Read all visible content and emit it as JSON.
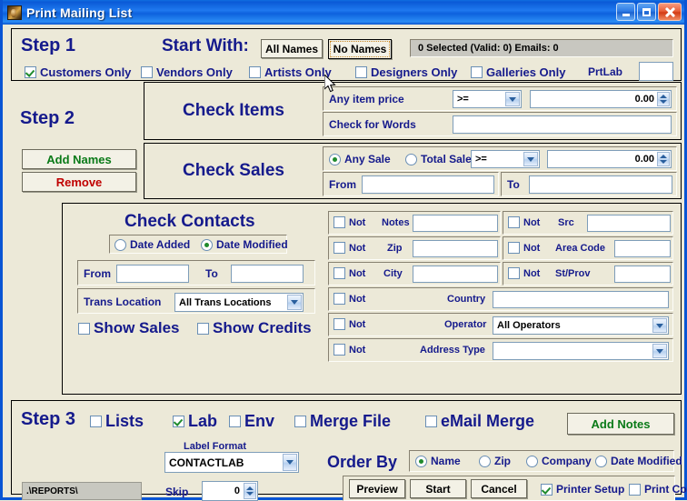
{
  "window": {
    "title": "Print Mailing List",
    "icon": "app-icon",
    "buttons": {
      "minimize": "_",
      "maximize": "□",
      "close": "✕"
    }
  },
  "step1": {
    "label": "Step 1",
    "start_with_label": "Start With:",
    "all_names_button": "All Names",
    "no_names_button": "No Names",
    "status": "0 Selected      (Valid: 0)  Emails: 0",
    "prtlab_label": "PrtLab",
    "prtlab_value": "",
    "checkboxes": [
      {
        "label": "Customers Only",
        "checked": true,
        "accel": "C"
      },
      {
        "label": "Vendors Only",
        "checked": false,
        "accel": "V"
      },
      {
        "label": "Artists Only",
        "checked": false,
        "accel": "A"
      },
      {
        "label": "Designers Only",
        "checked": false,
        "accel": "D"
      },
      {
        "label": "Galleries Only",
        "checked": false,
        "accel": "G"
      }
    ]
  },
  "step2": {
    "label": "Step 2",
    "add_names_button": "Add Names",
    "remove_button": "Remove",
    "check_items": {
      "title": "Check Items",
      "any_item_price_label": "Any item price",
      "operator_value": ">=",
      "operator_options": [
        ">=",
        "<=",
        "=",
        ">",
        "<"
      ],
      "price_value": "0.00",
      "check_for_words_label": "Check for Words",
      "check_for_words_value": ""
    },
    "check_sales": {
      "title": "Check Sales",
      "any_sale_label": "Any Sale",
      "any_sale_checked": true,
      "total_sales_label": "Total Sales",
      "total_sales_checked": false,
      "operator_value": ">=",
      "amount_value": "0.00",
      "from_label": "From",
      "from_value": "",
      "to_label": "To",
      "to_value": ""
    }
  },
  "check_contacts": {
    "title": "Check Contacts",
    "date_added_label": "Date Added",
    "date_added_checked": false,
    "date_modified_label": "Date Modified",
    "date_modified_checked": true,
    "from_label": "From",
    "from_value": "",
    "to_label": "To",
    "to_value": "",
    "trans_location_label": "Trans Location",
    "trans_location_value": "All Trans Locations",
    "show_sales_label": "Show Sales",
    "show_sales_checked": false,
    "show_credits_label": "Show Credits",
    "show_credits_checked": false
  },
  "filters": {
    "not_label": "Not",
    "rows": [
      {
        "name": "notes",
        "label": "Notes",
        "not_checked": false,
        "value": "",
        "type": "text"
      },
      {
        "name": "src",
        "label": "Src",
        "not_checked": false,
        "value": "",
        "type": "text"
      },
      {
        "name": "zip",
        "label": "Zip",
        "not_checked": false,
        "value": "",
        "type": "text"
      },
      {
        "name": "area-code",
        "label": "Area Code",
        "not_checked": false,
        "value": "",
        "type": "text"
      },
      {
        "name": "city",
        "label": "City",
        "not_checked": false,
        "value": "",
        "type": "text"
      },
      {
        "name": "st-prov",
        "label": "St/Prov",
        "not_checked": false,
        "value": "",
        "type": "text"
      },
      {
        "name": "country",
        "label": "Country",
        "not_checked": false,
        "value": "",
        "type": "text"
      },
      {
        "name": "operator",
        "label": "Operator",
        "not_checked": false,
        "value": "All Operators",
        "type": "combo"
      },
      {
        "name": "address-type",
        "label": "Address Type",
        "not_checked": false,
        "value": "",
        "type": "combo"
      }
    ]
  },
  "step3": {
    "label": "Step 3",
    "outputs": [
      {
        "label": "Lists",
        "checked": false,
        "accel": "L"
      },
      {
        "label": "Lab",
        "checked": true,
        "accel": "b"
      },
      {
        "label": "Env",
        "checked": false,
        "accel": "v"
      },
      {
        "label": "Merge File",
        "checked": false,
        "accel": "M"
      },
      {
        "label": "eMail Merge",
        "checked": false,
        "accel": "e"
      }
    ],
    "add_notes_button": "Add Notes",
    "label_format_label": "Label Format",
    "label_format_value": "CONTACTLAB",
    "report_path": ".\\REPORTS\\",
    "skip_label": "Skip",
    "skip_value": "0",
    "order_by_label": "Order By",
    "order_by_options": [
      {
        "label": "Name",
        "checked": true
      },
      {
        "label": "Zip",
        "checked": false
      },
      {
        "label": "Company",
        "checked": false
      },
      {
        "label": "Date Modified",
        "checked": false
      }
    ],
    "preview_button": "Preview",
    "start_button": "Start",
    "cancel_button": "Cancel",
    "printer_setup_label": "Printer Setup",
    "printer_setup_checked": true,
    "print_cover_label": "Print Cover",
    "print_cover_checked": false
  },
  "colors": {
    "face": "#ece9d8",
    "title_blue": "#0a55d4",
    "label_navy": "#151a8c",
    "accent_green": "#0a7a18",
    "accent_red": "#c00000"
  }
}
